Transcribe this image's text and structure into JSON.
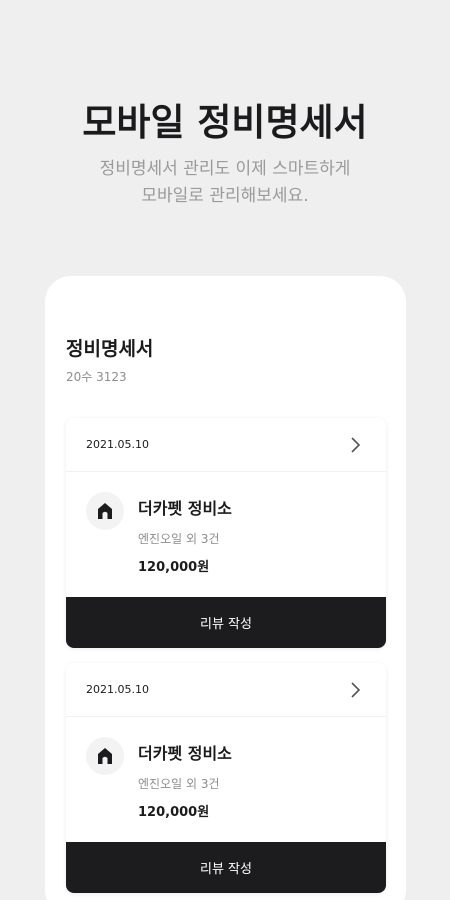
{
  "hero": {
    "title": "모바일 정비명세서",
    "subtitle_line1": "정비명세서 관리도 이제 스마트하게",
    "subtitle_line2": "모바일로 관리해보세요."
  },
  "card": {
    "title": "정비명세서",
    "car_number": "20수 3123"
  },
  "records": [
    {
      "date": "2021.05.10",
      "shop_name": "더카펫 정비소",
      "items": "엔진오일 외 3건",
      "price": "120,000원",
      "button_label": "리뷰 작성"
    },
    {
      "date": "2021.05.10",
      "shop_name": "더카펫 정비소",
      "items": "엔진오일 외 3건",
      "price": "120,000원",
      "button_label": "리뷰 작성"
    }
  ],
  "icons": {
    "chevron": "chevron-right-icon",
    "shop_logo": "shop-logo-icon"
  },
  "colors": {
    "background": "#efefef",
    "text_primary": "#1b1b1d",
    "text_secondary": "#9a9a9a",
    "button": "#1c1c1f"
  }
}
